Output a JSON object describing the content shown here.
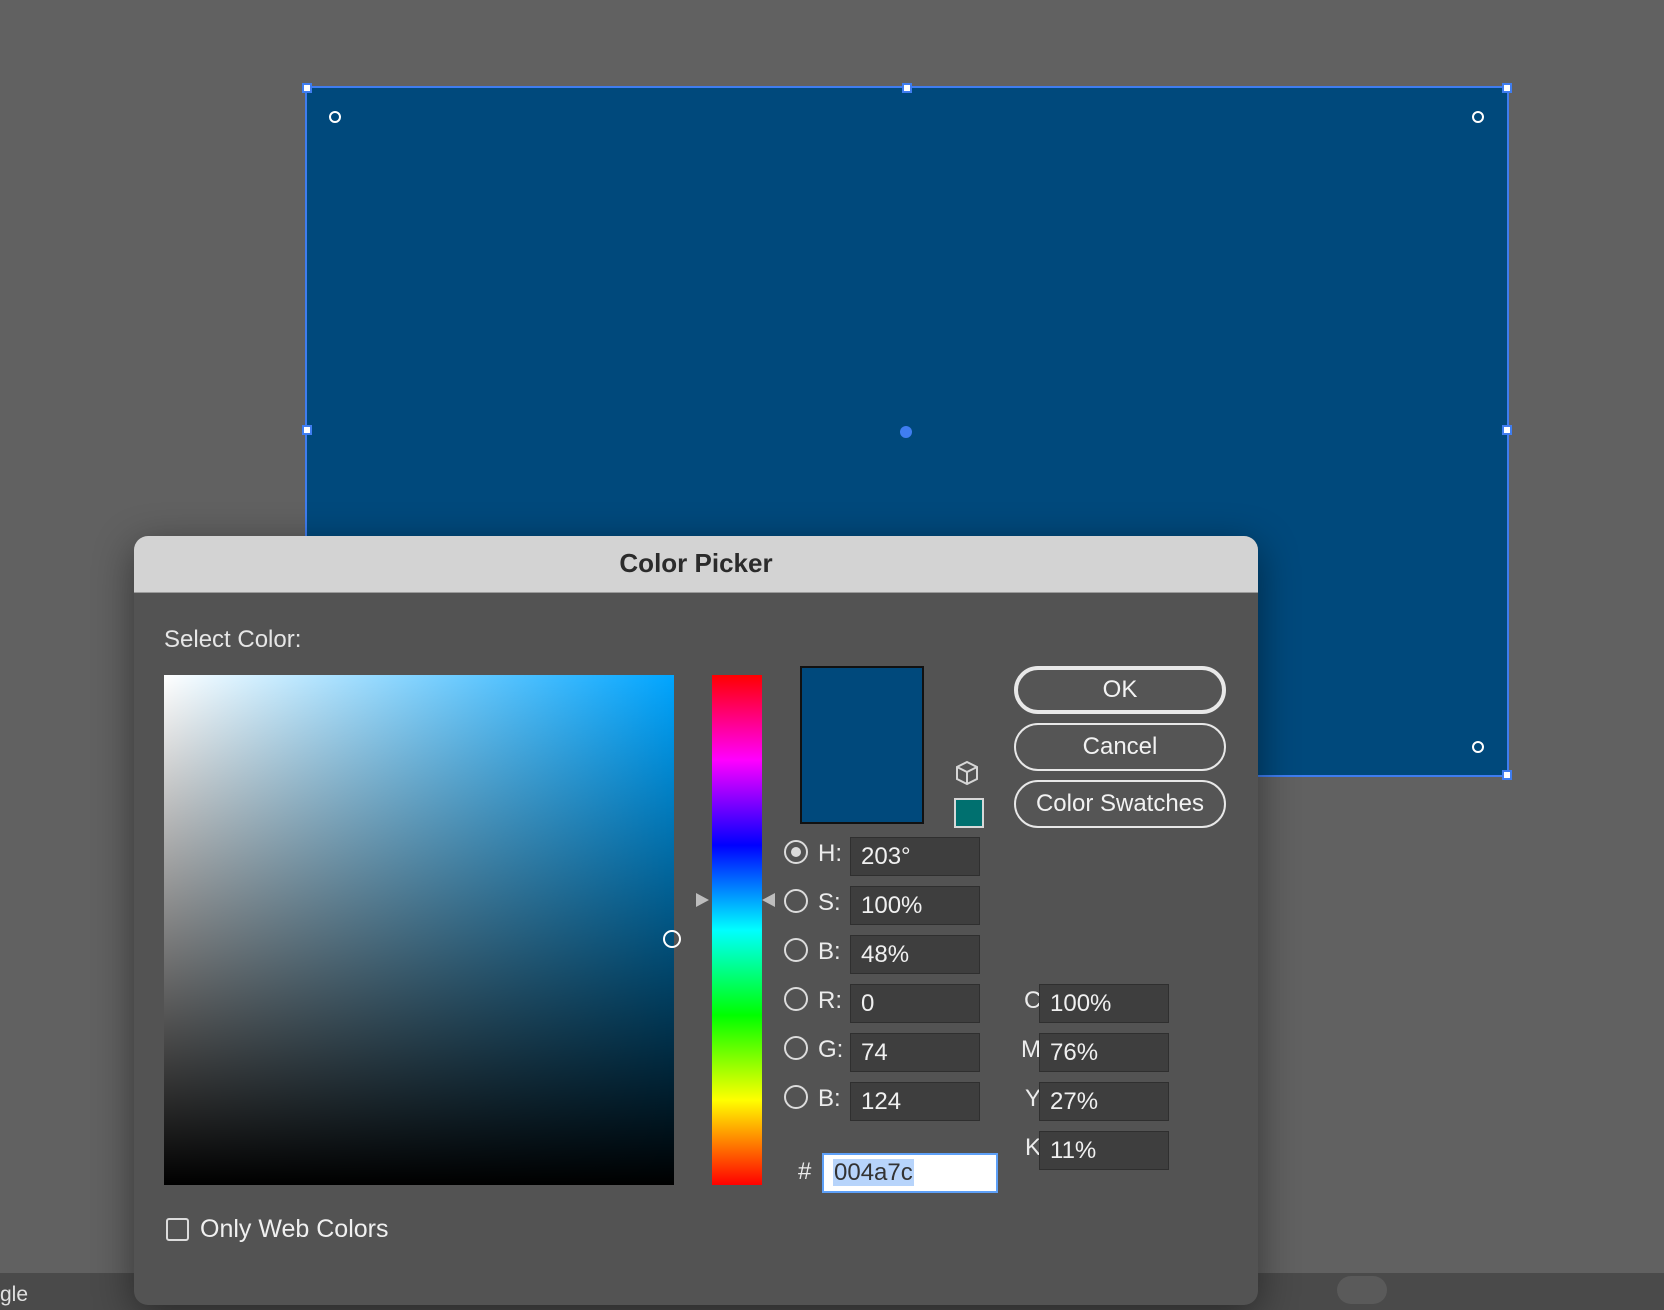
{
  "canvas": {
    "shape_fill": "#00497c",
    "selection_color": "#3f7df0",
    "status_text": "gle"
  },
  "dialog": {
    "title": "Color Picker",
    "select_label": "Select Color:",
    "buttons": {
      "ok": "OK",
      "cancel": "Cancel",
      "swatches": "Color Swatches"
    },
    "current_color": "#00497c",
    "gamut_warning_color": "#00706f",
    "hue_marker_fraction": 0.44,
    "hsb": {
      "h": {
        "label": "H:",
        "value": "203°",
        "selected": true
      },
      "s": {
        "label": "S:",
        "value": "100%"
      },
      "b": {
        "label": "B:",
        "value": "48%"
      }
    },
    "rgb": {
      "r": {
        "label": "R:",
        "value": "0"
      },
      "g": {
        "label": "G:",
        "value": "74"
      },
      "b": {
        "label": "B:",
        "value": "124"
      }
    },
    "hex": {
      "label": "#",
      "value": "004a7c"
    },
    "cmyk": {
      "c": {
        "label": "C:",
        "value": "100%"
      },
      "m": {
        "label": "M:",
        "value": "76%"
      },
      "y": {
        "label": "Y:",
        "value": "27%"
      },
      "k": {
        "label": "K:",
        "value": "11%"
      }
    },
    "web_colors": {
      "label": "Only Web Colors",
      "checked": false
    },
    "icons": {
      "gamut_cube": "cube-icon"
    }
  }
}
